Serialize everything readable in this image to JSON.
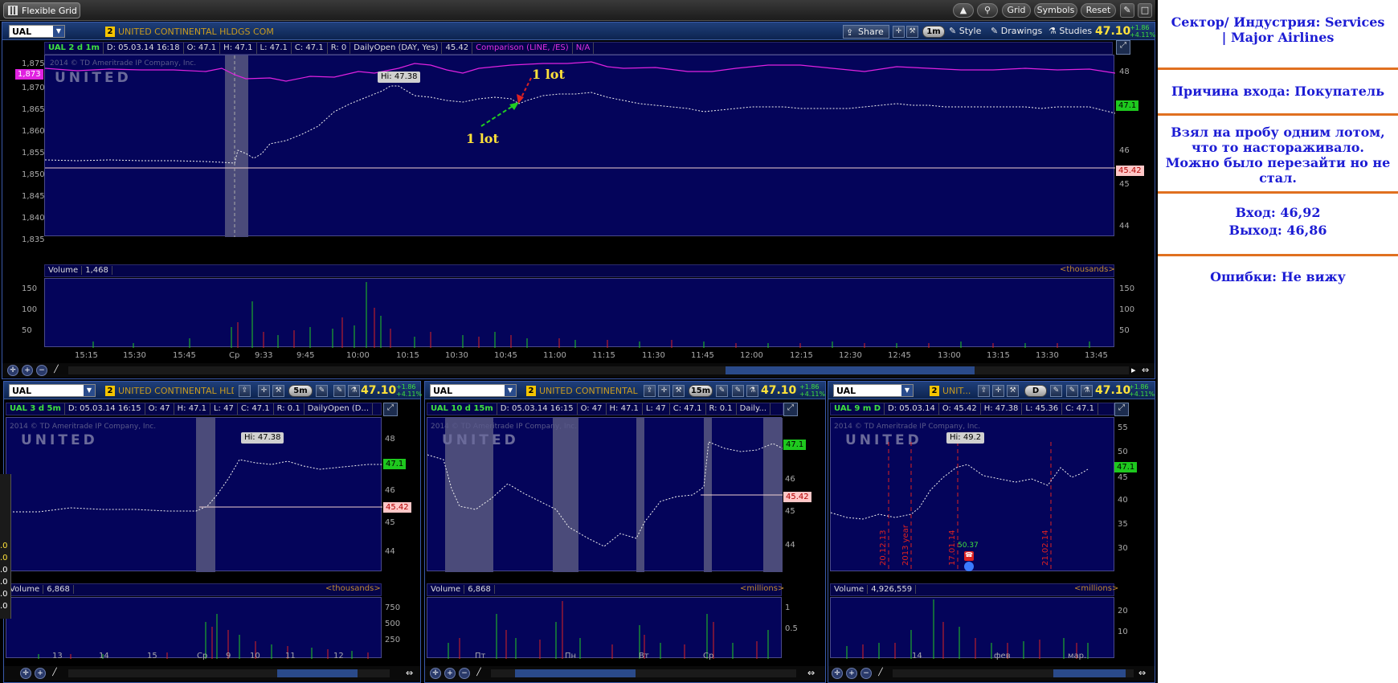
{
  "toolbar": {
    "title": "Flexible Grid",
    "buttons": [
      "Grid",
      "Symbols",
      "Reset"
    ]
  },
  "main": {
    "symbol": "UAL",
    "badge": "2",
    "company": "UNITED CONTINENTAL HLDGS COM",
    "actions": [
      "Share",
      "1m",
      "Style",
      "Drawings",
      "Studies"
    ],
    "price": "47.10",
    "change": "+1.86",
    "change_pct": "+4.11%",
    "info": [
      "UAL 2 d 1m",
      "D: 05.03.14 16:18",
      "O: 47.1",
      "H: 47.1",
      "L: 47.1",
      "C: 47.1",
      "R: 0",
      "DailyOpen (DAY, Yes)",
      "45.42"
    ],
    "comparison": [
      "Comparison (LINE, /ES)",
      "N/A"
    ],
    "watermark": "2014 © TD Ameritrade IP Company, Inc.",
    "logo": "UNITED",
    "hi_label": "Hi: 47.38",
    "left_tag": "1,873",
    "left_axis": [
      "1,875",
      "1,870",
      "1,865",
      "1,860",
      "1,855",
      "1,850",
      "1,845",
      "1,840",
      "1,835"
    ],
    "right_axis": [
      "48",
      "47",
      "46",
      "45",
      "44"
    ],
    "last_tag": "47.1",
    "open_tag": "45.42",
    "annotation_red": "1 lot",
    "annotation_green": "1 lot",
    "volume_label": "Volume",
    "volume_value": "1,468",
    "volume_units": "<thousands>",
    "volume_axis": [
      "150",
      "100",
      "50"
    ],
    "x_axis": [
      "15:15",
      "15:30",
      "15:45",
      "Ср",
      "9:33",
      "9:45",
      "10:00",
      "10:15",
      "10:30",
      "10:45",
      "11:00",
      "11:15",
      "11:30",
      "11:45",
      "12:00",
      "12:15",
      "12:30",
      "12:45",
      "13:00",
      "13:15",
      "13:30",
      "13:45"
    ]
  },
  "sub1": {
    "symbol": "UAL",
    "badge": "2",
    "company": "UNITED CONTINENTAL HLD...",
    "tf": "5m",
    "price": "47.10",
    "change": "+1.86",
    "change_pct": "+4.11%",
    "info": [
      "UAL 3 d 5m",
      "D: 05.03.14 16:15",
      "O: 47",
      "H: 47.1",
      "L: 47",
      "C: 47.1",
      "R: 0.1",
      "DailyOpen (D..."
    ],
    "watermark": "2014 © TD Ameritrade IP Company, Inc.",
    "logo": "UNITED",
    "hi_label": "Hi: 47.38",
    "right_axis": [
      "48",
      "47",
      "46",
      "45",
      "44"
    ],
    "last_tag": "47.1",
    "open_tag": "45.42",
    "volume_label": "Volume",
    "volume_value": "6,868",
    "volume_units": "<thousands>",
    "volume_axis": [
      "750",
      "500",
      "250"
    ],
    "x_axis": [
      "13",
      "14",
      "15",
      "Ср",
      "9",
      "10",
      "11",
      "12"
    ]
  },
  "sub2": {
    "symbol": "UAL",
    "badge": "2",
    "company": "UNITED CONTINENTAL ...",
    "tf": "15m",
    "price": "47.10",
    "change": "+1.86",
    "change_pct": "+4.11%",
    "info": [
      "UAL 10 d 15m",
      "D: 05.03.14 16:15",
      "O: 47",
      "H: 47.1",
      "L: 47",
      "C: 47.1",
      "R: 0.1",
      "Daily..."
    ],
    "watermark": "2014 © TD Ameritrade IP Company, Inc.",
    "logo": "UNITED",
    "right_axis": [
      "48",
      "47",
      "46",
      "45",
      "44"
    ],
    "last_tag": "47.1",
    "open_tag": "45.42",
    "volume_label": "Volume",
    "volume_value": "6,868",
    "volume_units": "<millions>",
    "volume_axis": [
      "1",
      "0.5"
    ],
    "x_axis": [
      "Пт",
      "Пн",
      "Вт",
      "Ср"
    ]
  },
  "sub3": {
    "symbol": "UAL",
    "badge": "2",
    "company": "UNIT...",
    "tf": "D",
    "price": "47.10",
    "change": "+1.86",
    "change_pct": "+4.11%",
    "info": [
      "UAL 9 m D",
      "D: 05.03.14",
      "O: 45.42",
      "H: 47.38",
      "L: 45.36",
      "C: 47.1"
    ],
    "watermark": "2014 © TD Ameritrade IP Company, Inc.",
    "logo": "UNITED",
    "hi_label": "Hi: 49.2",
    "right_axis": [
      "55",
      "50",
      "45",
      "40",
      "35",
      "30"
    ],
    "last_tag": "47.1",
    "event_label": "50.37",
    "date_lines": [
      "20.12.13",
      "2013 year",
      "17.01.14",
      "21.02.14"
    ],
    "volume_label": "Volume",
    "volume_value": "4,926,559",
    "volume_units": "<millions>",
    "volume_axis": [
      "20",
      "10"
    ],
    "x_axis": [
      "14",
      "фев",
      "мар."
    ]
  },
  "left_stub_values": [
    ".0",
    ".0",
    ".0",
    ".0",
    ".0",
    ".0"
  ],
  "notes": {
    "sector": "Сектор/ Индустрия: Services | Major Airlines",
    "reason": "Причина входа: Покупатель",
    "comment": "Взял на пробу одним лотом, что то настораживало. Можно было перезайти но не стал.",
    "entry": "Вход: 46,92",
    "exit": "Выход: 46,86",
    "errors": "Ошибки: Не вижу"
  },
  "colors": {
    "accent_panel": "#04045a",
    "up": "#22cc22",
    "down": "#dd2222",
    "price": "#ffe23a",
    "notes_text": "#1c1cd4",
    "notes_rule": "#e07020"
  }
}
